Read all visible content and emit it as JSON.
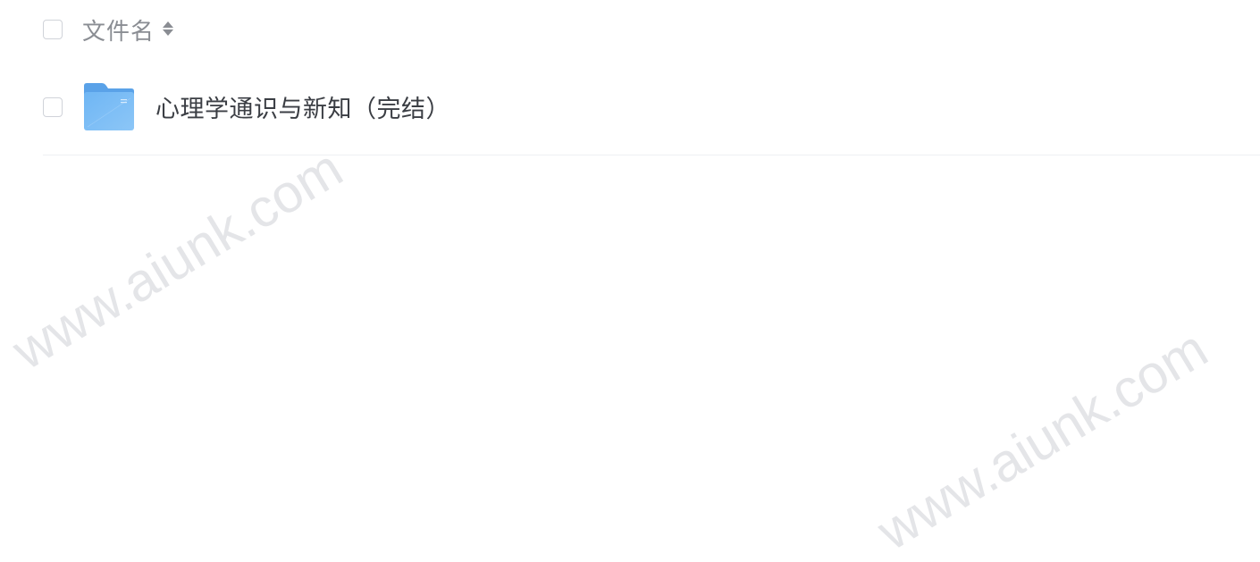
{
  "header": {
    "column_label": "文件名"
  },
  "files": [
    {
      "name": "心理学通识与新知（完结）",
      "type": "folder"
    }
  ],
  "watermarks": [
    "www.aiunk.com",
    "www.aiunk.com"
  ],
  "colors": {
    "folder_blue": "#66aef0",
    "folder_tab": "#5aa2e8",
    "header_text": "#8a8d93",
    "name_text": "#3b3e44",
    "divider": "#eef0f3"
  }
}
